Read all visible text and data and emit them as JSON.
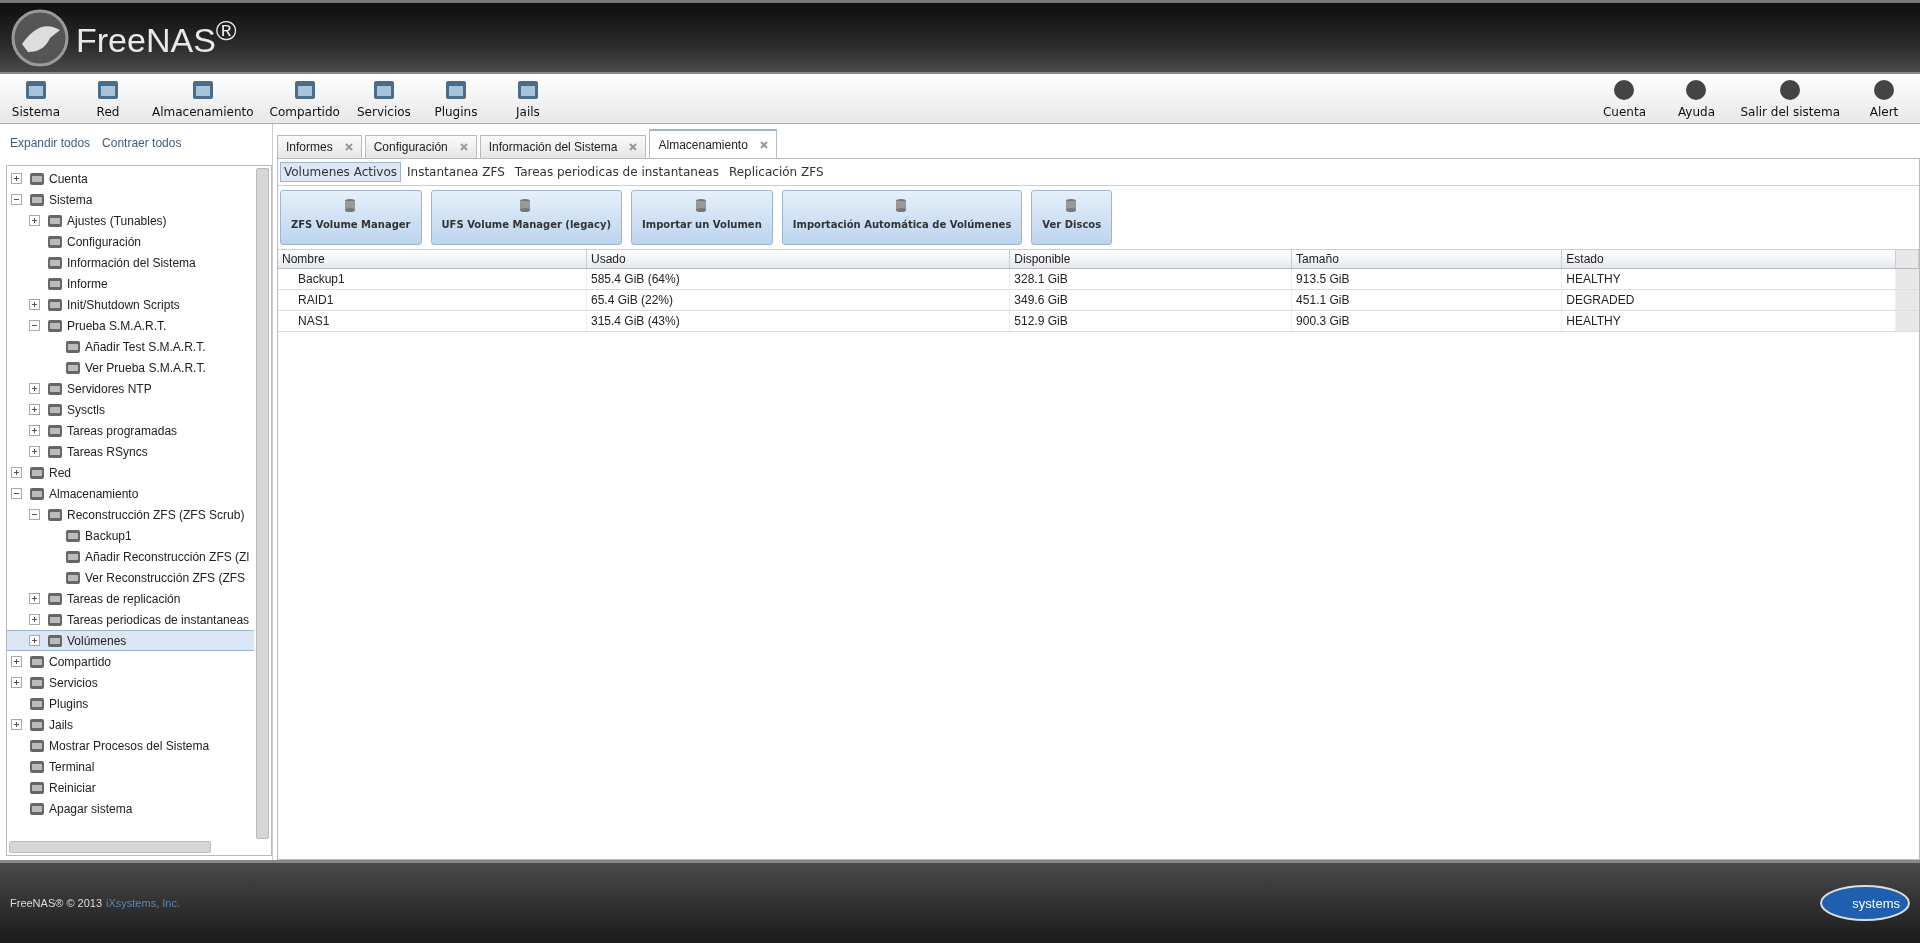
{
  "header": {
    "logo_text": "FreeNAS$^{®}$"
  },
  "toolbar": {
    "left": [
      {
        "label": "Sistema"
      },
      {
        "label": "Red"
      },
      {
        "label": "Almacenamiento"
      },
      {
        "label": "Compartido"
      },
      {
        "label": "Servicios"
      },
      {
        "label": "Plugins"
      },
      {
        "label": "Jails"
      }
    ],
    "right": [
      {
        "label": "Cuenta"
      },
      {
        "label": "Ayuda"
      },
      {
        "label": "Salir del sistema"
      },
      {
        "label": "Alert"
      }
    ]
  },
  "sidebar": {
    "links": [
      "Expandir todos",
      "Contraer todos"
    ],
    "tree": [
      {
        "label": "Cuenta",
        "kind": "folder",
        "expanded": false,
        "selected": false
      },
      {
        "label": "Sistema",
        "kind": "folder",
        "expanded": true,
        "selected": false,
        "children": [
          {
            "label": "Ajustes (Tunables)",
            "kind": "folder",
            "expanded": false,
            "selected": false
          },
          {
            "label": "Configuración",
            "kind": "leaf",
            "selected": false
          },
          {
            "label": "Información del Sistema",
            "kind": "leaf",
            "selected": false
          },
          {
            "label": "Informe",
            "kind": "leaf",
            "selected": false
          },
          {
            "label": "Init/Shutdown Scripts",
            "kind": "folder",
            "expanded": false,
            "selected": false
          },
          {
            "label": "Prueba S.M.A.R.T.",
            "kind": "folder",
            "expanded": true,
            "selected": false,
            "children": [
              {
                "label": "Añadir Test S.M.A.R.T.",
                "kind": "leaf",
                "selected": false
              },
              {
                "label": "Ver Prueba S.M.A.R.T.",
                "kind": "leaf",
                "selected": false
              }
            ]
          },
          {
            "label": "Servidores NTP",
            "kind": "folder",
            "expanded": false,
            "selected": false
          },
          {
            "label": "Sysctls",
            "kind": "folder",
            "expanded": false,
            "selected": false
          },
          {
            "label": "Tareas programadas",
            "kind": "folder",
            "expanded": false,
            "selected": false
          },
          {
            "label": "Tareas RSyncs",
            "kind": "folder",
            "expanded": false,
            "selected": false
          }
        ]
      },
      {
        "label": "Red",
        "kind": "folder",
        "expanded": false,
        "selected": false
      },
      {
        "label": "Almacenamiento",
        "kind": "folder",
        "expanded": true,
        "selected": false,
        "children": [
          {
            "label": "Reconstrucción ZFS (ZFS Scrub)",
            "kind": "folder",
            "expanded": true,
            "selected": false,
            "children": [
              {
                "label": "Backup1",
                "kind": "leaf",
                "selected": false
              },
              {
                "label": "Añadir Reconstrucción ZFS (Zl",
                "kind": "leaf",
                "selected": false
              },
              {
                "label": "Ver Reconstrucción ZFS (ZFS",
                "kind": "leaf",
                "selected": false
              }
            ]
          },
          {
            "label": "Tareas de replicación",
            "kind": "folder",
            "expanded": false,
            "selected": false
          },
          {
            "label": "Tareas periodicas de instantaneas",
            "kind": "folder",
            "expanded": false,
            "selected": false
          },
          {
            "label": "Volúmenes",
            "kind": "folder",
            "expanded": false,
            "selected": true
          }
        ]
      },
      {
        "label": "Compartido",
        "kind": "folder",
        "expanded": false,
        "selected": false
      },
      {
        "label": "Servicios",
        "kind": "folder",
        "expanded": false,
        "selected": false
      },
      {
        "label": "Plugins",
        "kind": "leaf",
        "selected": false
      },
      {
        "label": "Jails",
        "kind": "folder",
        "expanded": false,
        "selected": false
      },
      {
        "label": "Mostrar Procesos del Sistema",
        "kind": "leaf",
        "selected": false
      },
      {
        "label": "Terminal",
        "kind": "leaf",
        "selected": false
      },
      {
        "label": "Reiniciar",
        "kind": "leaf",
        "selected": false
      },
      {
        "label": "Apagar sistema",
        "kind": "leaf",
        "selected": false
      }
    ]
  },
  "tabs": [
    {
      "label": "Informes",
      "selected": false
    },
    {
      "label": "Configuración",
      "selected": false
    },
    {
      "label": "Información del Sistema",
      "selected": false
    },
    {
      "label": "Almacenamiento",
      "selected": true
    }
  ],
  "subtabs": [
    {
      "label": "Volumenes Activos",
      "selected": true
    },
    {
      "label": "Instantanea ZFS",
      "selected": false
    },
    {
      "label": "Tareas periodicas de instantaneas",
      "selected": false
    },
    {
      "label": "Replicación ZFS",
      "selected": false
    }
  ],
  "actions": [
    "ZFS Volume Manager",
    "UFS Volume Manager (legacy)",
    "Importar un Volumen",
    "Importación Automática de Volúmenes",
    "Ver Discos"
  ],
  "table": {
    "columns": [
      "Nombre",
      "Usado",
      "Disponible",
      "Tamaño",
      "Estado"
    ],
    "rows": [
      [
        "Backup1",
        "585.4 GiB (64%)",
        "328.1 GiB",
        "913.5 GiB",
        "HEALTHY"
      ],
      [
        "RAID1",
        "65.4 GiB (22%)",
        "349.6 GiB",
        "451.1 GiB",
        "DEGRADED"
      ],
      [
        "NAS1",
        "315.4 GiB (43%)",
        "512.9 GiB",
        "900.3 GiB",
        "HEALTHY"
      ]
    ]
  },
  "footer": {
    "text": "FreeNAS® © 2013",
    "link": "iXsystems, Inc.",
    "logo_text": "systems"
  }
}
